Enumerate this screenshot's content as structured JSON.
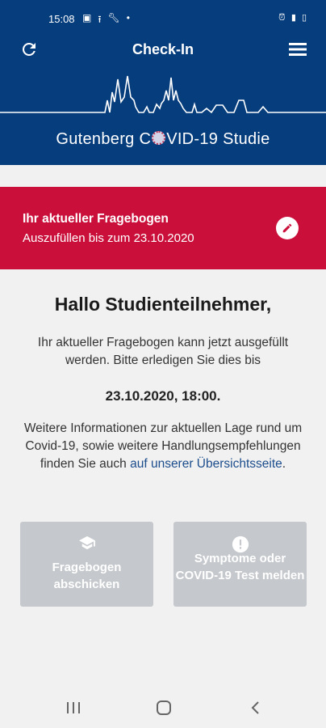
{
  "status_bar": {
    "time": "15:08",
    "left_icons": [
      "gallery-icon",
      "upload-icon",
      "wrench-icon",
      "dot-icon"
    ],
    "right_icons": [
      "alarm-icon",
      "signal-icon",
      "battery-icon"
    ]
  },
  "app_bar": {
    "title": "Check-In",
    "refresh_icon": "refresh-icon",
    "menu_icon": "hamburger-menu-icon"
  },
  "hero": {
    "brand_before": "Gutenberg C",
    "brand_after": "VID-19 Studie"
  },
  "banner": {
    "title": "Ihr aktueller Fragebogen",
    "subtitle": "Auszufüllen bis zum 23.10.2020",
    "background": "#c90f3a",
    "action_icon": "pencil-icon"
  },
  "main": {
    "greeting": "Hallo Studienteilnehmer,",
    "intro": "Ihr aktueller Fragebogen kann jetzt ausgefüllt werden. Bitte erledigen Sie dies bis",
    "deadline": "23.10.2020, 18:00.",
    "info_text": "Weitere Informationen zur aktuellen Lage rund um Covid-19, sowie weitere Handlungsempfehlungen finden Sie auch ",
    "info_link": "auf unserer Übersichtsseite",
    "info_end": "."
  },
  "actions": [
    {
      "label": "Fragebogen abschicken",
      "icon": "graduation-cap-icon"
    },
    {
      "label": "Symptome oder COVID-19 Test melden",
      "icon": "alert-circle-icon"
    }
  ],
  "colors": {
    "primary": "#063d7c",
    "accent_red": "#c90f3a",
    "disabled_button": "#c5c8cc",
    "link": "#1c4d8c"
  }
}
